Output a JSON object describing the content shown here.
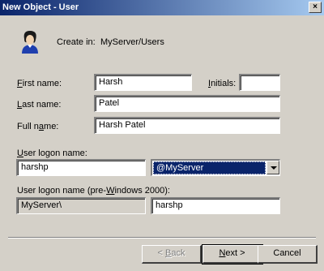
{
  "window": {
    "title": "New Object - User",
    "close_glyph": "×"
  },
  "header": {
    "icon": "user-icon",
    "create_in_label": "Create in:",
    "create_in_value": "MyServer/Users"
  },
  "form": {
    "first_name": {
      "label_pre": "",
      "label_key": "F",
      "label_post": "irst name:",
      "value": "Harsh"
    },
    "initials": {
      "label_pre": "",
      "label_key": "I",
      "label_post": "nitials:",
      "value": ""
    },
    "last_name": {
      "label_pre": "",
      "label_key": "L",
      "label_post": "ast name:",
      "value": "Patel"
    },
    "full_name": {
      "label_pre": "Full n",
      "label_key": "a",
      "label_post": "me:",
      "value": "Harsh Patel"
    },
    "logon_name": {
      "label_pre": "",
      "label_key": "U",
      "label_post": "ser logon name:",
      "value": "harshp",
      "domain": "@MyServer"
    },
    "logon_pre2000": {
      "label_pre": "User logon name (pre-",
      "label_key": "W",
      "label_post": "indows 2000):",
      "domain": "MyServer\\",
      "value": "harshp"
    }
  },
  "buttons": {
    "back": {
      "pre": "< ",
      "key": "B",
      "post": "ack"
    },
    "next": {
      "pre": "",
      "key": "N",
      "post": "ext >"
    },
    "cancel": {
      "label": "Cancel"
    }
  },
  "colors": {
    "face": "#d4d0c8",
    "title_start": "#0a246a",
    "title_end": "#a6caf0",
    "highlight": "#0a246a"
  }
}
